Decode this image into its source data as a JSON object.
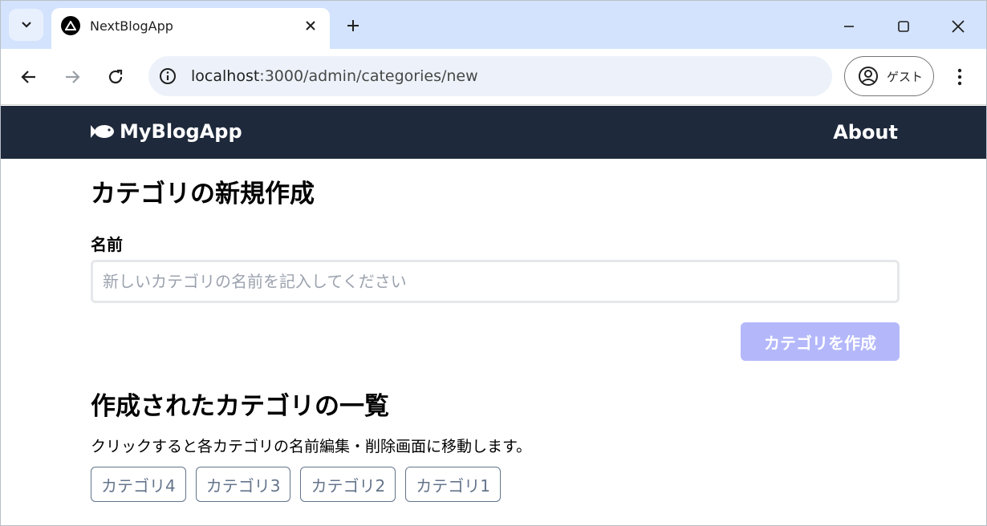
{
  "browser": {
    "tab_title": "NextBlogApp",
    "url_host": "localhost",
    "url_rest": ":3000/admin/categories/new",
    "guest_label": "ゲスト"
  },
  "site": {
    "brand": "MyBlogApp",
    "about": "About"
  },
  "form": {
    "title": "カテゴリの新規作成",
    "name_label": "名前",
    "name_value": "",
    "name_placeholder": "新しいカテゴリの名前を記入してください",
    "submit_label": "カテゴリを作成"
  },
  "list": {
    "title": "作成されたカテゴリの一覧",
    "description": "クリックすると各カテゴリの名前編集・削除画面に移動します。",
    "categories": [
      "カテゴリ4",
      "カテゴリ3",
      "カテゴリ2",
      "カテゴリ1"
    ]
  },
  "colors": {
    "header_bg": "#1e293b",
    "button_disabled": "#b4b8fb",
    "chip_border": "#64748b"
  }
}
